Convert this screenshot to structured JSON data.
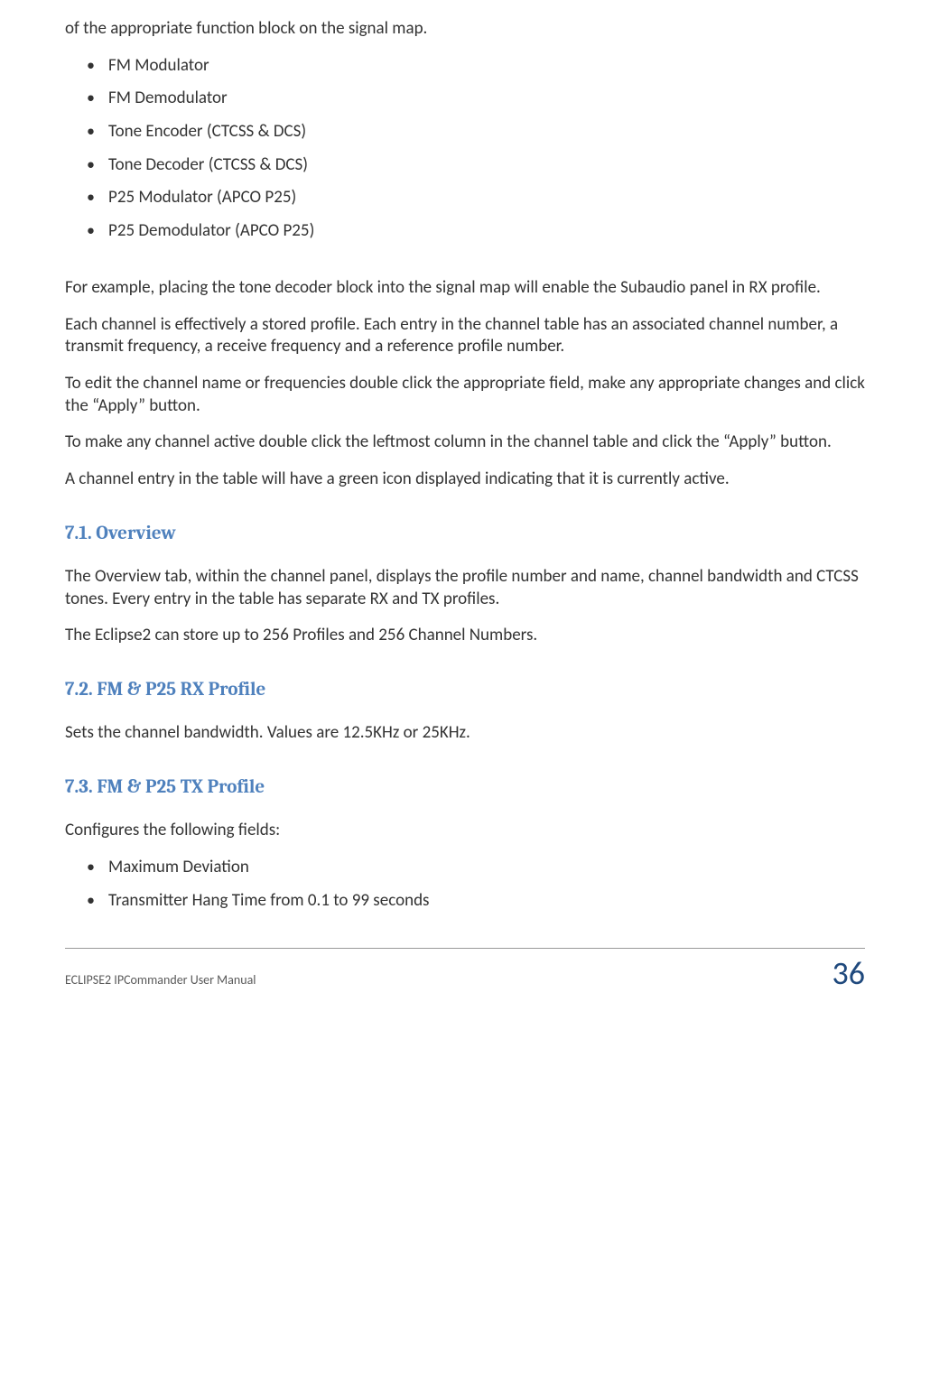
{
  "intro": "of the appropriate function block on the signal map.",
  "list1": [
    "FM Modulator",
    "FM Demodulator",
    "Tone Encoder (CTCSS & DCS)",
    "Tone Decoder (CTCSS & DCS)",
    "P25 Modulator (APCO P25)",
    "P25 Demodulator (APCO P25)"
  ],
  "p1": "For example, placing the tone decoder block into the signal map will enable the Subaudio panel in RX profile.",
  "p2": "Each channel is effectively a stored profile. Each entry in the channel table has an associated channel number, a transmit frequency, a receive frequency and a reference profile number.",
  "p3": "To edit the channel name or frequencies double click the appropriate field, make any appropriate changes and click the “Apply” button.",
  "p4": "To make any channel active double click the leftmost column in the channel table and click the “Apply” button.",
  "p5": "A channel entry in the table will have a green icon displayed indicating that it is currently active.",
  "sec71": {
    "heading": "7.1. Overview",
    "p1": "The Overview tab, within the channel panel, displays the profile number and name, channel bandwidth and CTCSS tones. Every entry in the table has separate RX and TX profiles.",
    "p2": "The Eclipse2 can store up to 256 Profiles and 256 Channel Numbers."
  },
  "sec72": {
    "heading": "7.2. FM & P25 RX Profile",
    "p1": "Sets the channel bandwidth.  Values are 12.5KHz or 25KHz."
  },
  "sec73": {
    "heading": "7.3. FM & P25 TX Profile",
    "p1": "Configures the following fields:",
    "list": [
      "Maximum Deviation",
      "Transmitter Hang Time from 0.1 to 99 seconds"
    ]
  },
  "footer": {
    "title": "ECLIPSE2 IPCommander User Manual",
    "page": "36"
  }
}
